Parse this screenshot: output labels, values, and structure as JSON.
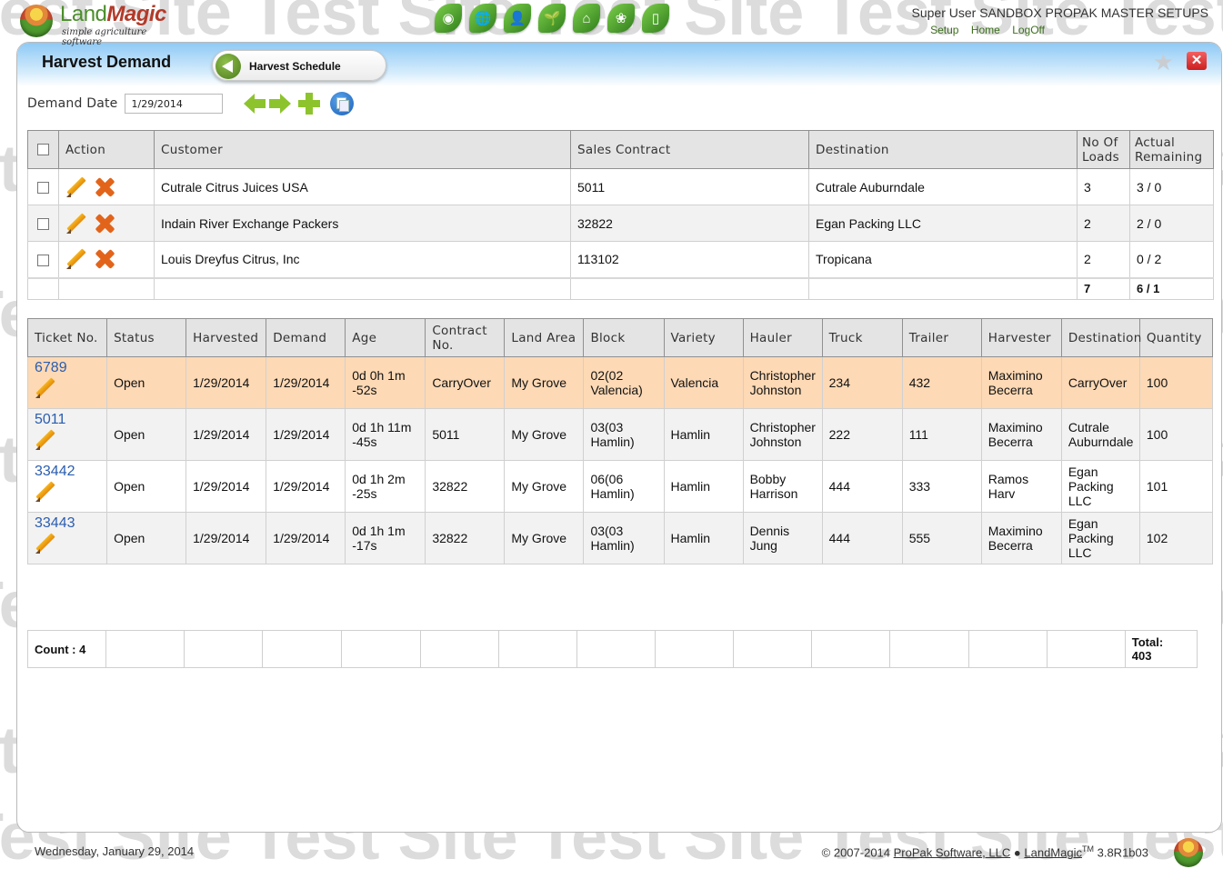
{
  "watermark": {
    "text": "Test Site"
  },
  "app": {
    "logo_name": "LandMagic",
    "logo_name_part1": "Land",
    "logo_name_part2": "Magic",
    "logo_tagline": "simple agriculture software",
    "app_icons": [
      {
        "name": "block-icon",
        "glyph": "◉",
        "label": "Block"
      },
      {
        "name": "globe-satellite-icon",
        "glyph": "🌐",
        "label": "Map"
      },
      {
        "name": "worker-clock-icon",
        "glyph": "👤",
        "label": "Labor"
      },
      {
        "name": "seedling-hands-icon",
        "glyph": "🌱",
        "label": "Crop"
      },
      {
        "name": "barn-checklist-icon",
        "glyph": "⌂",
        "label": "Farm"
      },
      {
        "name": "produce-icon",
        "glyph": "❀",
        "label": "Harvest"
      },
      {
        "name": "mobile-tablet-icon",
        "glyph": "▯",
        "label": "Mobile"
      }
    ],
    "user_name": "Super User SANDBOX PROPAK MASTER SETUPS",
    "nav_links": [
      "Setup",
      "Home",
      "LogOff"
    ]
  },
  "page": {
    "title": "Harvest Demand",
    "breadcrumb_back_label": "Harvest Schedule",
    "demand_date_label": "Demand Date",
    "demand_date_value": "1/29/2014",
    "toolbar": [
      "previous-day",
      "next-day",
      "add",
      "copy"
    ]
  },
  "demand_table": {
    "headers": {
      "action": "Action",
      "customer": "Customer",
      "sales_contract": "Sales Contract",
      "destination": "Destination",
      "no_of_loads": "No Of Loads",
      "actual_remaining": "Actual Remaining"
    },
    "rows": [
      {
        "customer": "Cutrale Citrus Juices USA",
        "sales_contract": "5011",
        "destination": "Cutrale Auburndale",
        "loads": "3",
        "actual_remaining": "3 / 0",
        "highlight": false
      },
      {
        "customer": "Indain River Exchange Packers",
        "sales_contract": "32822",
        "destination": "Egan Packing LLC",
        "loads": "2",
        "actual_remaining": "2 / 0",
        "highlight": false
      },
      {
        "customer": "Louis Dreyfus Citrus, Inc",
        "sales_contract": "113102",
        "destination": "Tropicana",
        "loads": "2",
        "actual_remaining": "0 / 2",
        "highlight": true
      }
    ],
    "totals": {
      "loads": "7",
      "actual_remaining": "6 / 1"
    },
    "highlight_color": "#e02020"
  },
  "ticket_table": {
    "headers": {
      "ticket_no": "Ticket No.",
      "status": "Status",
      "harvested": "Harvested",
      "demand": "Demand",
      "age": "Age",
      "contract_no": "Contract No.",
      "land_area": "Land Area",
      "block": "Block",
      "variety": "Variety",
      "hauler": "Hauler",
      "truck": "Truck",
      "trailer": "Trailer",
      "harvester": "Harvester",
      "destination": "Destination",
      "quantity": "Quantity"
    },
    "rows": [
      {
        "ticket_no": "6789",
        "status": "Open",
        "harvested": "1/29/2014",
        "demand": "1/29/2014",
        "age": "0d 0h 1m -52s",
        "contract_no": "CarryOver",
        "land_area": "My Grove",
        "block": "02(02 Valencia)",
        "variety": "Valencia",
        "hauler": "Christopher Johnston",
        "truck": "234",
        "trailer": "432",
        "harvester": "Maximino Becerra",
        "destination": "CarryOver",
        "quantity": "100",
        "selected": true
      },
      {
        "ticket_no": "5011",
        "status": "Open",
        "harvested": "1/29/2014",
        "demand": "1/29/2014",
        "age": "0d 1h 11m -45s",
        "contract_no": "5011",
        "land_area": "My Grove",
        "block": "03(03 Hamlin)",
        "variety": "Hamlin",
        "hauler": "Christopher Johnston",
        "truck": "222",
        "trailer": "111",
        "harvester": "Maximino Becerra",
        "destination": "Cutrale Auburndale",
        "quantity": "100",
        "selected": false
      },
      {
        "ticket_no": "33442",
        "status": "Open",
        "harvested": "1/29/2014",
        "demand": "1/29/2014",
        "age": "0d 1h 2m -25s",
        "contract_no": "32822",
        "land_area": "My Grove",
        "block": "06(06 Hamlin)",
        "variety": "Hamlin",
        "hauler": "Bobby Harrison",
        "truck": "444",
        "trailer": "333",
        "harvester": "Ramos Harv",
        "destination": "Egan Packing LLC",
        "quantity": "101",
        "selected": false
      },
      {
        "ticket_no": "33443",
        "status": "Open",
        "harvested": "1/29/2014",
        "demand": "1/29/2014",
        "age": "0d 1h 1m -17s",
        "contract_no": "32822",
        "land_area": "My Grove",
        "block": "03(03 Hamlin)",
        "variety": "Hamlin",
        "hauler": "Dennis Jung",
        "truck": "444",
        "trailer": "555",
        "harvester": "Maximino Becerra",
        "destination": "Egan Packing LLC",
        "quantity": "102",
        "selected": false
      }
    ],
    "selected_row_color": "#fdd9b5"
  },
  "summary": {
    "count_label": "Count : 4",
    "total_label": "Total:",
    "total_value": "403"
  },
  "footer": {
    "date": "Wednesday, January 29, 2014",
    "copyright_prefix": "© 2007-2014",
    "company_link": "ProPak Software, LLC",
    "separator": "●",
    "product_link": "LandMagic",
    "trademark": "TM",
    "version": "3.8R1b03"
  }
}
